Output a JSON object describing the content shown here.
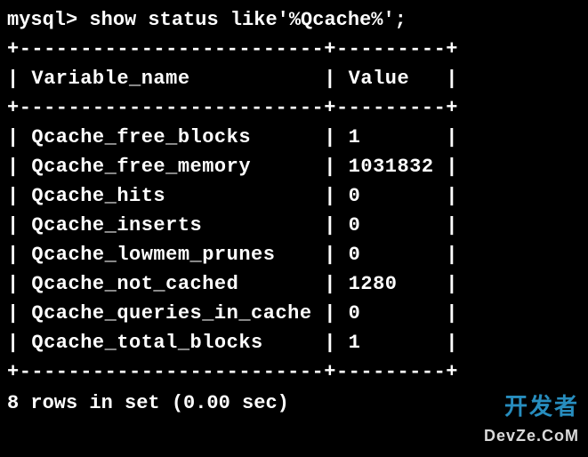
{
  "prompt": "mysql> ",
  "command": "show status like'%Qcache%';",
  "table": {
    "columns": [
      "Variable_name",
      "Value"
    ],
    "rows": [
      {
        "name": "Qcache_free_blocks",
        "value": "1"
      },
      {
        "name": "Qcache_free_memory",
        "value": "1031832"
      },
      {
        "name": "Qcache_hits",
        "value": "0"
      },
      {
        "name": "Qcache_inserts",
        "value": "0"
      },
      {
        "name": "Qcache_lowmem_prunes",
        "value": "0"
      },
      {
        "name": "Qcache_not_cached",
        "value": "1280"
      },
      {
        "name": "Qcache_queries_in_cache",
        "value": "0"
      },
      {
        "name": "Qcache_total_blocks",
        "value": "1"
      }
    ]
  },
  "footer": "8 rows in set (0.00 sec)",
  "border_segment1_len": 25,
  "border_segment2_len": 9,
  "watermark": {
    "line1": "开发者",
    "line2": "DevZe.CoM"
  }
}
